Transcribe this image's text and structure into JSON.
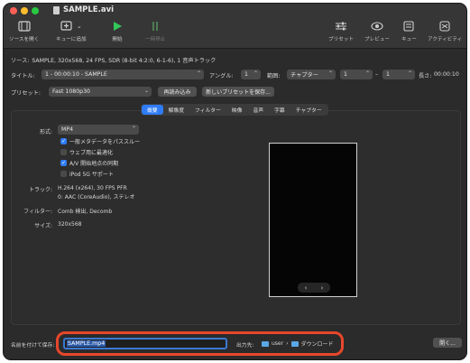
{
  "window": {
    "title": "SAMPLE.avi"
  },
  "toolbar": {
    "open_source": "ソースを開く",
    "add_to_queue": "キューに追加",
    "start": "開始",
    "pause": "一時停止",
    "presets": "プリセット",
    "preview": "プレビュー",
    "queue": "キュー",
    "activity": "アクティビティ"
  },
  "source": {
    "label": "ソース:",
    "info": "SAMPLE, 320x568, 24 FPS, SDR (8-bit 4:2:0, 6-1-6), 1 音声トラック"
  },
  "title_row": {
    "title_label": "タイトル:",
    "title_value": "1 - 00:00:10 - SAMPLE",
    "angle_label": "アングル:",
    "angle_value": "1",
    "range_label": "範囲:",
    "range_type": "チャプター",
    "range_start": "1",
    "range_sep": "–",
    "range_end": "1",
    "duration_label": "長さ:",
    "duration_value": "00:00:10"
  },
  "preset_row": {
    "label": "プリセット:",
    "value": "Fast 1080p30",
    "reload": "再読み込み",
    "save_new": "新しいプリセットを保存..."
  },
  "tabs": [
    "概要",
    "解像度",
    "フィルター",
    "映像",
    "音声",
    "字幕",
    "チャプター"
  ],
  "active_tab": "概要",
  "summary": {
    "format_label": "形式:",
    "format_value": "MP4",
    "options": [
      {
        "label": "一般メタデータをパススルー",
        "checked": true
      },
      {
        "label": "ウェブ用に最適化",
        "checked": false
      },
      {
        "label": "A/V 開始地点の同期",
        "checked": true
      },
      {
        "label": "iPod 5G サポート",
        "checked": false
      }
    ],
    "tracks_label": "トラック:",
    "tracks_line1": "H.264 (x264), 30 FPS PFR",
    "tracks_line2": "0: AAC (CoreAudio), ステレオ",
    "filters_label": "フィルター:",
    "filters_value": "Comb 検出, Decomb",
    "size_label": "サイズ:",
    "size_value": "320x568"
  },
  "preview_nav": {
    "prev": "‹",
    "next": "›"
  },
  "save": {
    "label": "名前を付けて保存:",
    "filename": "SAMPLE.mp4",
    "dest_label": "出力先:",
    "path_user": "user",
    "path_sep": "›",
    "path_folder": "ダウンロード",
    "browse": "開く..."
  },
  "colors": {
    "accent": "#2f7cf6",
    "highlight_outline": "#e8472c",
    "start_icon": "#33c759"
  }
}
